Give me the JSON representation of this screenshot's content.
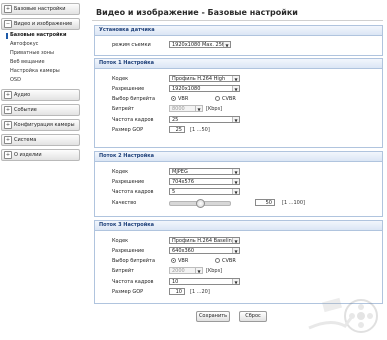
{
  "sidebar": {
    "sections": [
      {
        "label": "Базовые настройки",
        "open": false
      },
      {
        "label": "Видео и изображение",
        "open": true,
        "items": [
          {
            "label": "Базовые настройки",
            "active": true
          },
          {
            "label": "Автофокус"
          },
          {
            "label": "Приватные зоны"
          },
          {
            "label": "Веб вещание"
          },
          {
            "label": "Настройка камеры"
          },
          {
            "label": "OSD"
          }
        ]
      },
      {
        "label": "Аудио"
      },
      {
        "label": "Событие"
      },
      {
        "label": "Конфигурация камеры"
      },
      {
        "label": "Система"
      },
      {
        "label": "О изделии"
      }
    ]
  },
  "page": {
    "title": "Видео и изображение - Базовые настройки"
  },
  "sensor": {
    "header": "Установка датчика",
    "mode_label": "режим съемки",
    "mode_value": "1920x1080 Max. 25fps"
  },
  "stream1": {
    "header": "Поток 1 Настройка",
    "codec_label": "Кодек",
    "codec_value": "Профиль H.264 High",
    "res_label": "Разрешение",
    "res_value": "1920x1080",
    "bitrate_mode_label": "Выбор битрейта",
    "vbr": "VBR",
    "cbr": "CVBR",
    "bitrate_label": "Битрейт",
    "bitrate_value": "8000",
    "bitrate_unit": "[Kbps]",
    "fps_label": "Частота кадров",
    "fps_value": "25",
    "gop_label": "Размер GOP",
    "gop_value": "25",
    "gop_range": "[1 ...50]"
  },
  "stream2": {
    "header": "Поток 2 Настройка",
    "codec_label": "Кодек",
    "codec_value": "MJPEG",
    "res_label": "Разрешение",
    "res_value": "704x576",
    "fps_label": "Частота кадров",
    "fps_value": "5",
    "quality_label": "Качество",
    "quality_value": "50",
    "quality_range": "[1 ...100]",
    "quality_fraction": 0.5
  },
  "stream3": {
    "header": "Поток 3 Настройка",
    "codec_label": "Кодек",
    "codec_value": "Профиль H.264 Baseline",
    "res_label": "Разрешение",
    "res_value": "640x360",
    "bitrate_mode_label": "Выбор битрейта",
    "vbr": "VBR",
    "cbr": "CVBR",
    "bitrate_label": "Битрейт",
    "bitrate_value": "2000",
    "bitrate_unit": "[Kbps]",
    "fps_label": "Частота кадров",
    "fps_value": "10",
    "gop_label": "Размер GOP",
    "gop_value": "10",
    "gop_range": "[1 ...20]"
  },
  "buttons": {
    "save": "Сохранить",
    "reset": "Сброс"
  },
  "colors": {
    "group_border": "#b0c4de",
    "group_header": "#1d3f78",
    "active_marker": "#1e5aa8"
  }
}
